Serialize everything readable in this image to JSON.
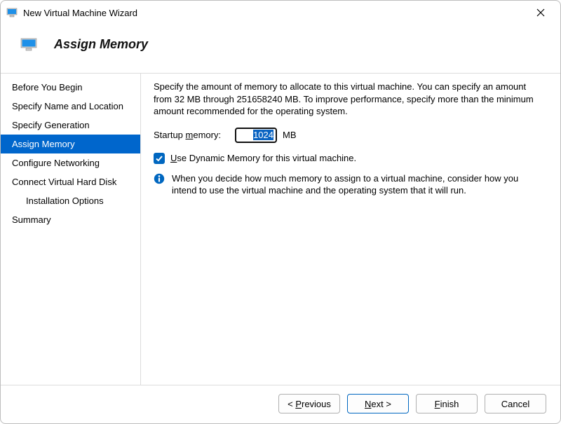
{
  "window": {
    "title": "New Virtual Machine Wizard"
  },
  "header": {
    "title": "Assign Memory"
  },
  "sidebar": {
    "items": [
      {
        "label": "Before You Begin",
        "selected": false,
        "indent": false
      },
      {
        "label": "Specify Name and Location",
        "selected": false,
        "indent": false
      },
      {
        "label": "Specify Generation",
        "selected": false,
        "indent": false
      },
      {
        "label": "Assign Memory",
        "selected": true,
        "indent": false
      },
      {
        "label": "Configure Networking",
        "selected": false,
        "indent": false
      },
      {
        "label": "Connect Virtual Hard Disk",
        "selected": false,
        "indent": false
      },
      {
        "label": "Installation Options",
        "selected": false,
        "indent": true
      },
      {
        "label": "Summary",
        "selected": false,
        "indent": false
      }
    ]
  },
  "content": {
    "description": "Specify the amount of memory to allocate to this virtual machine. You can specify an amount from 32 MB through 251658240 MB. To improve performance, specify more than the minimum amount recommended for the operating system.",
    "memory_label_prefix": "Startup ",
    "memory_label_underlined": "m",
    "memory_label_suffix": "emory:",
    "memory_value": "1024",
    "memory_unit": "MB",
    "dynamic_checkbox_checked": true,
    "dynamic_label_underlined": "U",
    "dynamic_label_rest": "se Dynamic Memory for this virtual machine.",
    "info_text": "When you decide how much memory to assign to a virtual machine, consider how you intend to use the virtual machine and the operating system that it will run."
  },
  "footer": {
    "previous_prefix": "< ",
    "previous_u": "P",
    "previous_rest": "revious",
    "next_u": "N",
    "next_rest": "ext >",
    "finish_u": "F",
    "finish_rest": "inish",
    "cancel": "Cancel"
  }
}
